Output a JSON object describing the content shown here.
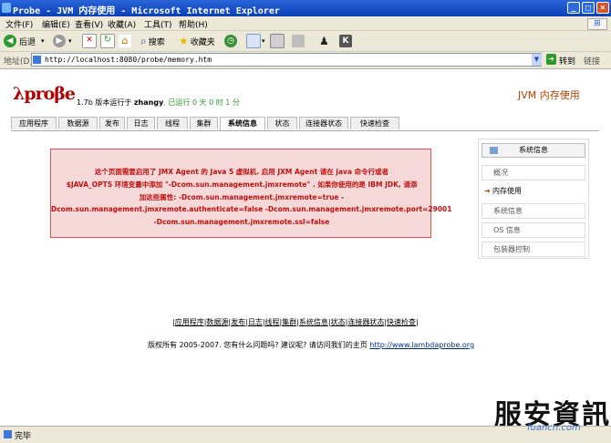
{
  "window": {
    "title": "Probe - JVM 内存使用 - Microsoft Internet Explorer",
    "buttons": [
      "_",
      "□",
      "×"
    ]
  },
  "menu": [
    "文件(F)",
    "编辑(E)",
    "查看(V)",
    "收藏(A)",
    "工具(T)",
    "帮助(H)"
  ],
  "toolbar": {
    "back": "后退",
    "search": "搜索",
    "favorites": "收藏夹"
  },
  "address": {
    "label": "地址(D)",
    "url": "http://localhost:8080/probe/memory.htm",
    "go": "转到",
    "links": "链接"
  },
  "app": {
    "logo": "λproβe",
    "version_prefix": "1.7b 版本运行于 ",
    "user": "zhangy",
    "uptime": ", 已运行 0 天 0 时 1 分",
    "page_heading": "JVM 内存使用"
  },
  "tabs": [
    "应用程序",
    "数据源",
    "发布",
    "日志",
    "线程",
    "集群",
    "系统信息",
    "状态",
    "连接器状态",
    "快速检查"
  ],
  "active_tab": "系统信息",
  "warning": {
    "lines": [
      "这个页面需要启用了 JMX Agent 的 Java 5 虚拟机. 启用 JXM Agent 请在 java 命令行或者",
      "$JAVA_OPTS 环境变量中添加 \"-Dcom.sun.management.jmxremote\" . 如果你使用的是 IBM JDK, 请添",
      "加这些属性: -Dcom.sun.management.jmxremote=true -",
      "Dcom.sun.management.jmxremote.authenticate=false -Dcom.sun.management.jmxremote.port=29001",
      "-Dcom.sun.management.jmxremote.ssl=false"
    ],
    "color": "#c01010"
  },
  "sidebar": {
    "header": "系统信息",
    "items": [
      "概况",
      "内存使用",
      "系统信息",
      "OS 信息",
      "包装器控制"
    ],
    "current": "内存使用"
  },
  "footer": {
    "links": [
      "应用程序",
      "数据源",
      "发布",
      "日志",
      "线程",
      "集群",
      "系统信息",
      "状态",
      "连接器状态",
      "快速检查"
    ],
    "copyright": "版权所有 2005-2007. 您有什么问题吗? 建议呢? 请访问我们的主页",
    "homepage": "http://www.lambdaprobe.org"
  },
  "status": {
    "text": "完毕"
  },
  "watermark": {
    "text": "服安資訊",
    "sub": "fuancn.com"
  },
  "colors": {
    "brand_red": "#b00000",
    "titlebar_blue": "#0a3fb8",
    "uptime_green": "#339933"
  }
}
